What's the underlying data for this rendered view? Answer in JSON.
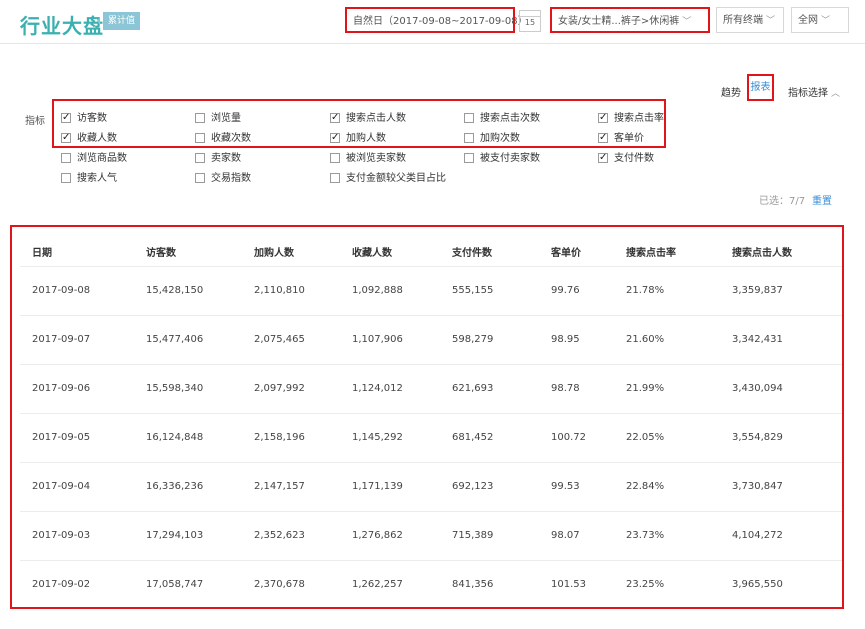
{
  "header": {
    "title": "行业大盘",
    "tag": "累计值",
    "date_range": "自然日（2017-09-08~2017-09-08）",
    "calendar_day": "15",
    "category": "女装/女士精...裤子>休闲裤",
    "terminal": "所有终端",
    "network": "全网"
  },
  "view": {
    "trend": "趋势",
    "report": "报表",
    "metric_select": "指标选择"
  },
  "metrics": {
    "label": "指标",
    "items": [
      {
        "label": "访客数",
        "checked": true
      },
      {
        "label": "浏览量",
        "checked": false
      },
      {
        "label": "搜索点击人数",
        "checked": true
      },
      {
        "label": "搜索点击次数",
        "checked": false
      },
      {
        "label": "搜索点击率",
        "checked": true
      },
      {
        "label": "收藏人数",
        "checked": true
      },
      {
        "label": "收藏次数",
        "checked": false
      },
      {
        "label": "加购人数",
        "checked": true
      },
      {
        "label": "加购次数",
        "checked": false
      },
      {
        "label": "客单价",
        "checked": true
      },
      {
        "label": "浏览商品数",
        "checked": false
      },
      {
        "label": "卖家数",
        "checked": false
      },
      {
        "label": "被浏览卖家数",
        "checked": false
      },
      {
        "label": "被支付卖家数",
        "checked": false
      },
      {
        "label": "支付件数",
        "checked": true
      },
      {
        "label": "搜索人气",
        "checked": false
      },
      {
        "label": "交易指数",
        "checked": false
      },
      {
        "label": "支付金额较父类目占比",
        "checked": false
      }
    ],
    "selected": "已选：7/7",
    "reset": "重置"
  },
  "table": {
    "headers": [
      "日期",
      "访客数",
      "加购人数",
      "收藏人数",
      "支付件数",
      "客单价",
      "搜索点击率",
      "搜索点击人数"
    ],
    "rows": [
      [
        "2017-09-08",
        "15,428,150",
        "2,110,810",
        "1,092,888",
        "555,155",
        "99.76",
        "21.78%",
        "3,359,837"
      ],
      [
        "2017-09-07",
        "15,477,406",
        "2,075,465",
        "1,107,906",
        "598,279",
        "98.95",
        "21.60%",
        "3,342,431"
      ],
      [
        "2017-09-06",
        "15,598,340",
        "2,097,992",
        "1,124,012",
        "621,693",
        "98.78",
        "21.99%",
        "3,430,094"
      ],
      [
        "2017-09-05",
        "16,124,848",
        "2,158,196",
        "1,145,292",
        "681,452",
        "100.72",
        "22.05%",
        "3,554,829"
      ],
      [
        "2017-09-04",
        "16,336,236",
        "2,147,157",
        "1,171,139",
        "692,123",
        "99.53",
        "22.84%",
        "3,730,847"
      ],
      [
        "2017-09-03",
        "17,294,103",
        "2,352,623",
        "1,276,862",
        "715,389",
        "98.07",
        "23.73%",
        "4,104,272"
      ],
      [
        "2017-09-02",
        "17,058,747",
        "2,370,678",
        "1,262,257",
        "841,356",
        "101.53",
        "23.25%",
        "3,965,550"
      ]
    ]
  },
  "colors": {
    "brand": "#3ab0b0",
    "highlight": "#e0141b",
    "link": "#3a8fd9"
  }
}
